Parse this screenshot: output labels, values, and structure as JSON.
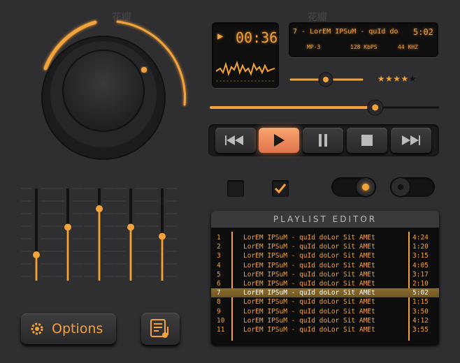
{
  "lcd_time": {
    "time": "00:36"
  },
  "lcd_track": {
    "title": "7 - LorEM IPSuM - quId do",
    "length": "5:02",
    "format": "MP-3",
    "bitrate": "128 KbPS",
    "khz": "44 KHZ"
  },
  "controls": {
    "rating": 4,
    "rating_max": 5,
    "volume": 0.52,
    "seek": 0.72,
    "toggle_on": true,
    "checkbox1": false,
    "checkbox2": true
  },
  "eq": {
    "levels": [
      0.28,
      0.58,
      0.78,
      0.58,
      0.48
    ]
  },
  "transport": {
    "prev": "prev",
    "play": "play",
    "pause": "pause",
    "stop": "stop",
    "next": "next"
  },
  "playlist": {
    "header": "PLAYLIST EDITOR",
    "rows": [
      {
        "num": "1",
        "title": "LorEM IPSuM - quId doLor Sit AMEt",
        "dur": "4:24"
      },
      {
        "num": "2",
        "title": "LorEM IPSuM - quId doLor Sit AMEt",
        "dur": "1:20"
      },
      {
        "num": "3",
        "title": "LorEM IPSuM - quId doLor Sit AMEt",
        "dur": "3:15"
      },
      {
        "num": "4",
        "title": "LorEM IPSuM - quId doLor Sit AMEt",
        "dur": "4:05"
      },
      {
        "num": "5",
        "title": "LorEM IPSuM - quId doLor Sit AMEt",
        "dur": "3:17"
      },
      {
        "num": "6",
        "title": "LorEM IPSuM - quId doLor Sit AMEt",
        "dur": "2:10"
      },
      {
        "num": "7",
        "title": "LorEM IPSuM - quId doLor Sit AMEt",
        "dur": "5:02",
        "selected": true
      },
      {
        "num": "8",
        "title": "LorEM IPSuM - quId doLor Sit AMEt",
        "dur": "1:15"
      },
      {
        "num": "9",
        "title": "LorEM IPSuM - quId doLor Sit AMEt",
        "dur": "3:50"
      },
      {
        "num": "10",
        "title": "LorEM IPSuM - quId doLor Sit AMEt",
        "dur": "4:12"
      },
      {
        "num": "11",
        "title": "LorEM IPSuM - quId doLor Sit AMEt",
        "dur": "3:55"
      }
    ]
  },
  "buttons": {
    "options": "Options"
  },
  "icons": {
    "gear": "gear-icon",
    "playlist_note": "playlist-note-icon"
  },
  "colors": {
    "accent": "#f3a33a",
    "bg": "#2f2e31",
    "lcd": "#0f0f10"
  }
}
